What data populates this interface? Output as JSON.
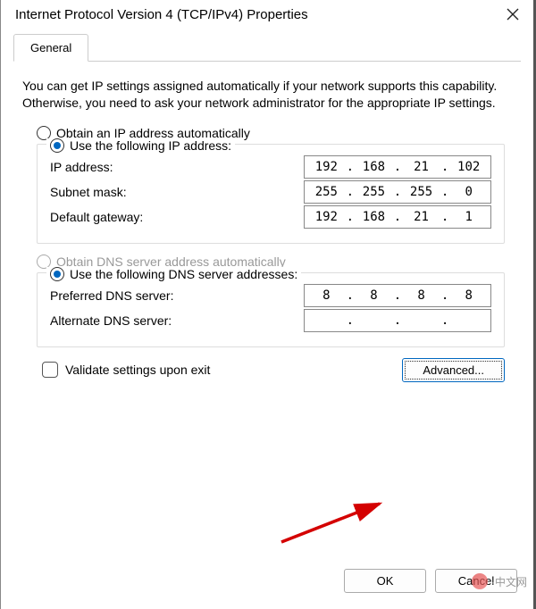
{
  "title": "Internet Protocol Version 4 (TCP/IPv4) Properties",
  "tabs": {
    "general": "General"
  },
  "intro": "You can get IP settings assigned automatically if your network supports this capability. Otherwise, you need to ask your network administrator for the appropriate IP settings.",
  "ip_section": {
    "auto_label": "Obtain an IP address automatically",
    "manual_label": "Use the following IP address:",
    "ip_label": "IP address:",
    "subnet_label": "Subnet mask:",
    "gateway_label": "Default gateway:",
    "ip": {
      "o1": "192",
      "o2": "168",
      "o3": "21",
      "o4": "102"
    },
    "subnet": {
      "o1": "255",
      "o2": "255",
      "o3": "255",
      "o4": "0"
    },
    "gateway": {
      "o1": "192",
      "o2": "168",
      "o3": "21",
      "o4": "1"
    }
  },
  "dns_section": {
    "auto_label": "Obtain DNS server address automatically",
    "manual_label": "Use the following DNS server addresses:",
    "preferred_label": "Preferred DNS server:",
    "alternate_label": "Alternate DNS server:",
    "preferred": {
      "o1": "8",
      "o2": "8",
      "o3": "8",
      "o4": "8"
    },
    "alternate": {
      "o1": "",
      "o2": "",
      "o3": "",
      "o4": ""
    }
  },
  "validate_label": "Validate settings upon exit",
  "buttons": {
    "advanced": "Advanced...",
    "ok": "OK",
    "cancel": "Cancel"
  },
  "watermark": "·中文网"
}
